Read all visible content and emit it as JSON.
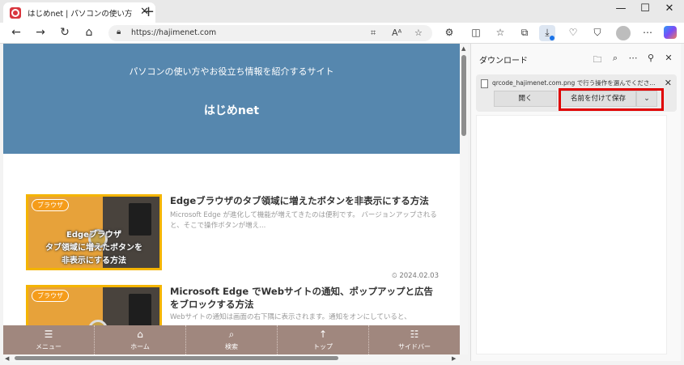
{
  "browser": {
    "tab_title": "はじめnet | パソコンの使い方やお役立ち",
    "url": "https://hajimenet.com",
    "reader_icon_label": "Aͅ",
    "window_controls": {
      "minimize": "—",
      "maximize": "☐",
      "close": "✕"
    }
  },
  "site": {
    "tagline": "パソコンの使い方やお役立ち情報を紹介するサイト",
    "name": "はじめnet"
  },
  "articles": [
    {
      "badge": "ブラウザ",
      "thumb_lines": [
        "Edgeブラウザ",
        "タブ領域に増えたボタンを",
        "非表示にする方法"
      ],
      "headline": "Edgeブラウザのタブ領域に増えたボタンを非表示にする方法",
      "excerpt": "Microsoft Edge が進化して機能が増えてきたのは便利です。 バージョンアップされると、そこで操作ボタンが増え...",
      "date": "2024.02.03"
    },
    {
      "badge": "ブラウザ",
      "headline": "Microsoft Edge でWebサイトの通知、ポップアップと広告をブロックする方法",
      "excerpt": "Webサイトの通知は画面の右下隅に表示されます。通知をオンにしていると、"
    }
  ],
  "bottom_nav": [
    {
      "icon": "menu-icon",
      "glyph": "☰",
      "label": "メニュー"
    },
    {
      "icon": "home-icon",
      "glyph": "⌂",
      "label": "ホーム"
    },
    {
      "icon": "search-icon",
      "glyph": "⌕",
      "label": "検索"
    },
    {
      "icon": "up-arrow-icon",
      "glyph": "↑",
      "label": "トップ"
    },
    {
      "icon": "sidebar-icon",
      "glyph": "☷",
      "label": "サイドバー"
    }
  ],
  "downloads": {
    "title": "ダウンロード",
    "file_name": "qrcode_hajimenet.com.png で行う操作を選んでくださ...",
    "open_label": "開く",
    "save_as_label": "名前を付けて保存",
    "more_glyph": "⌄"
  },
  "colors": {
    "hero": "#5687ae",
    "bottom_nav": "#a0877e",
    "highlight": "#e00000",
    "accent": "#1a73e8"
  }
}
